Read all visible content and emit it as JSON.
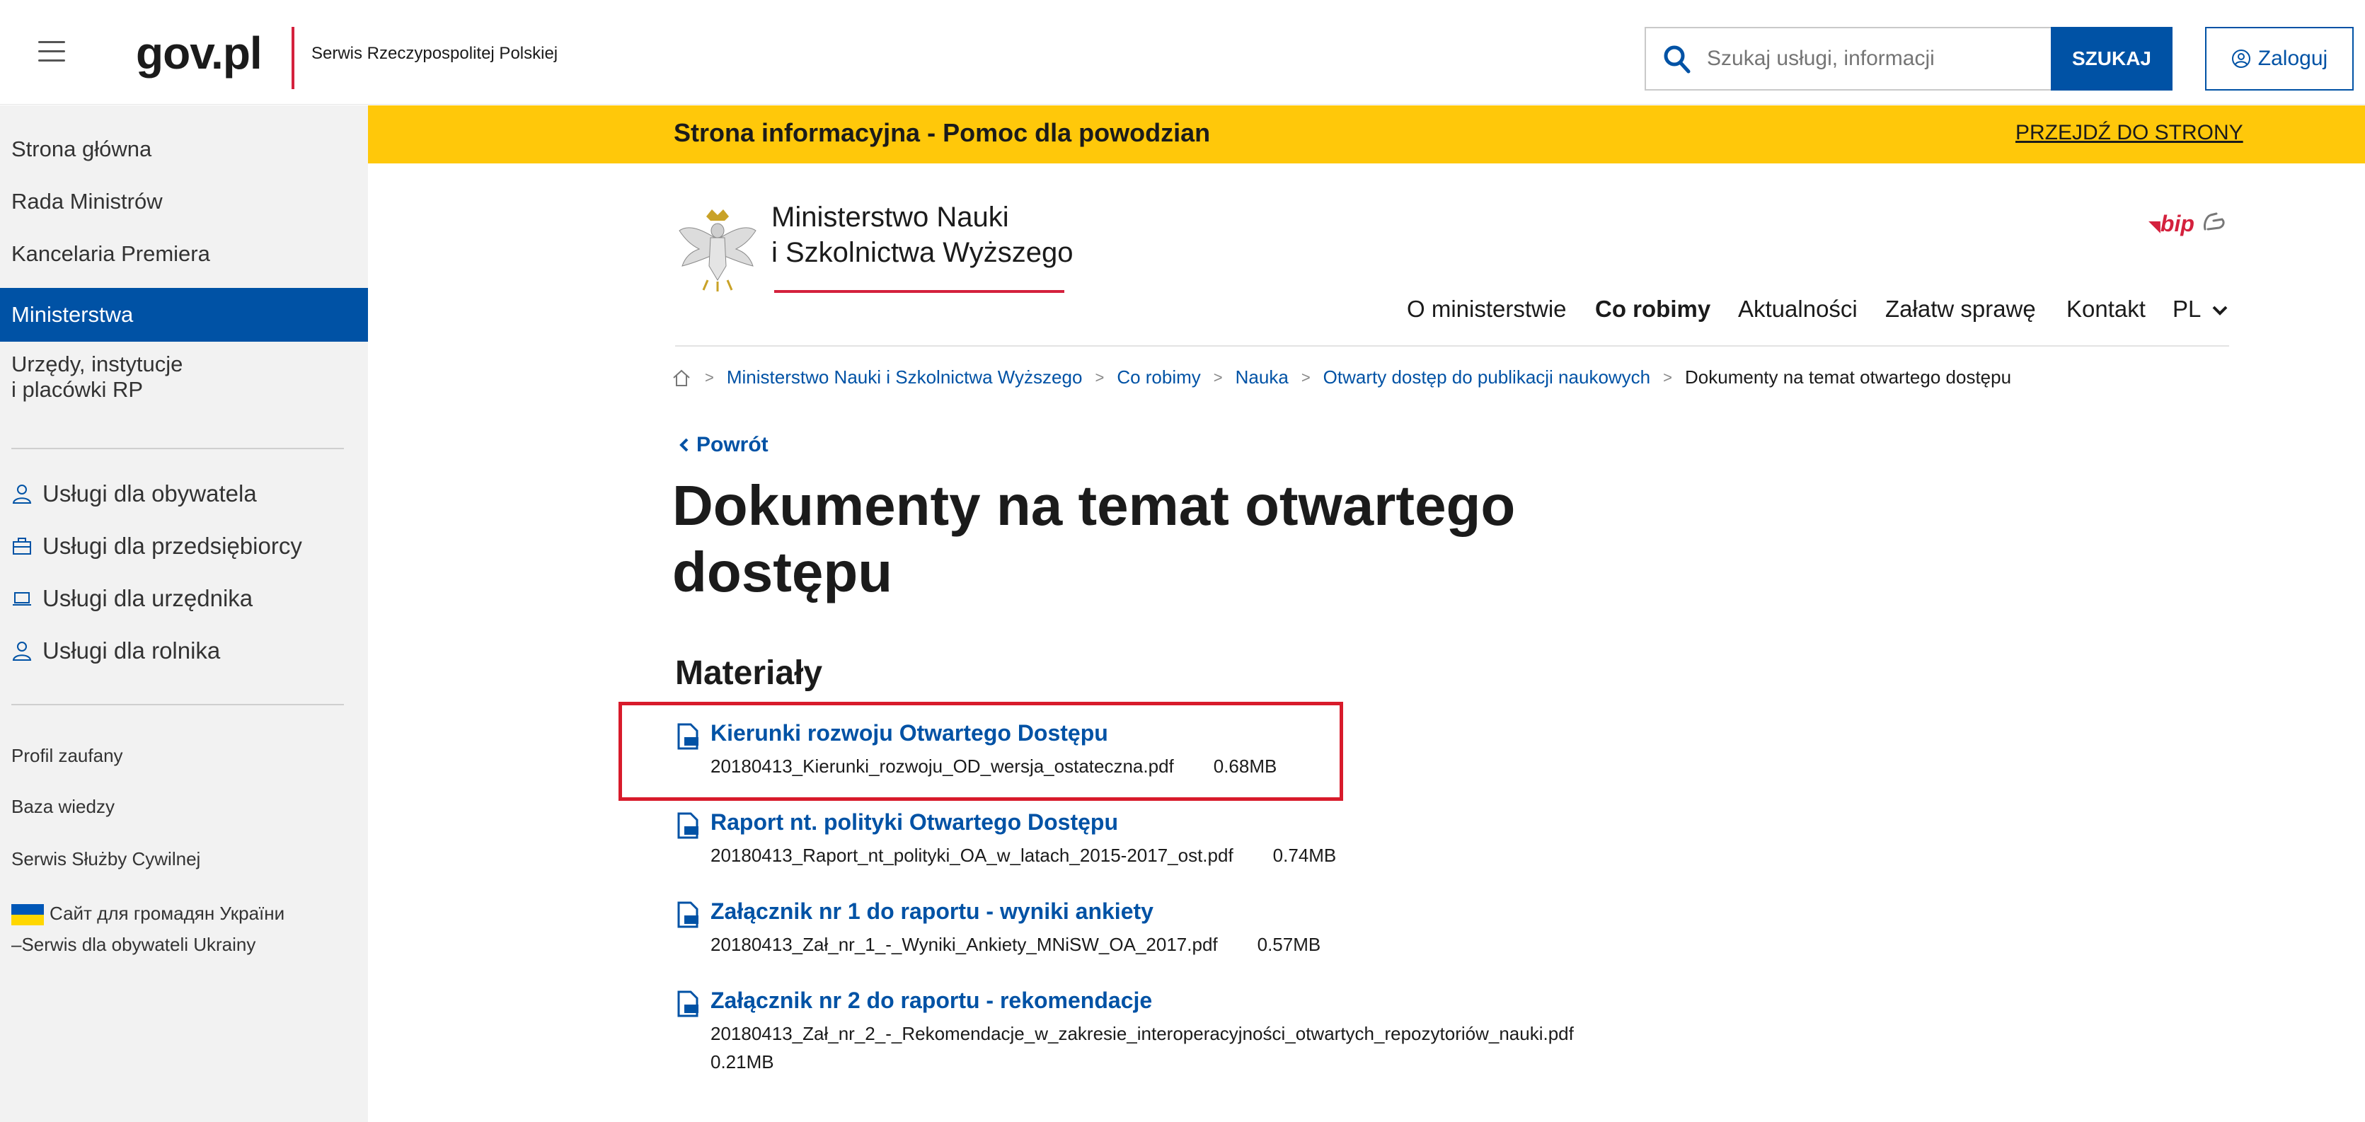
{
  "header": {
    "logo": "gov.pl",
    "serwis": "Serwis Rzeczypospolitej Polskiej",
    "search_placeholder": "Szukaj usługi, informacji",
    "search_button": "SZUKAJ",
    "login": "Zaloguj"
  },
  "banner": {
    "title": "Strona informacyjna - Pomoc dla powodzian",
    "link": "PRZEJDŹ DO STRONY",
    "color": "#ffc80a"
  },
  "sidebar": {
    "main": [
      "Strona główna",
      "Rada Ministrów",
      "Kancelaria Premiera",
      "Ministerstwa",
      "Urzędy, instytucje",
      "i placówki RP"
    ],
    "active": "Ministerstwa",
    "services": [
      {
        "label": "Usługi dla obywatela",
        "icon": "person-icon"
      },
      {
        "label": "Usługi dla przedsiębiorcy",
        "icon": "briefcase-icon"
      },
      {
        "label": "Usługi dla urzędnika",
        "icon": "laptop-icon"
      },
      {
        "label": "Usługi dla rolnika",
        "icon": "person-icon"
      }
    ],
    "small": [
      "Profil zaufany",
      "Baza wiedzy",
      "Serwis Służby Cywilnej"
    ],
    "ukraine_line1": "Сайт для громадян України",
    "ukraine_line2": "–Serwis dla obywateli Ukrainy"
  },
  "ministry": {
    "name_line1": "Ministerstwo Nauki",
    "name_line2": "i Szkolnictwa Wyższego",
    "bip": "bip"
  },
  "nav": [
    "O ministerstwie",
    "Co robimy",
    "Aktualności",
    "Załatw sprawę",
    "Kontakt",
    "PL"
  ],
  "breadcrumb": [
    "Ministerstwo Nauki i Szkolnictwa Wyższego",
    "Co robimy",
    "Nauka",
    "Otwarty dostęp do publikacji naukowych",
    "Dokumenty na temat otwartego dostępu"
  ],
  "back": "Powrót",
  "title_line1": "Dokumenty na temat otwartego",
  "title_line2": "dostępu",
  "section": "Materiały",
  "files": [
    {
      "title": "Kierunki rozwoju Otwartego Dostępu",
      "file": "20180413_Kierunki_rozwoju_OD_wersja_ostateczna.pdf",
      "size": "0.68MB"
    },
    {
      "title": "Raport nt. polityki Otwartego Dostępu",
      "file": "20180413_Raport_nt_polityki_OA_w_latach_2015-2017_ost.pdf",
      "size": "0.74MB"
    },
    {
      "title": "Załącznik nr 1 do raportu - wyniki ankiety",
      "file": "20180413_Zał_nr_1_-_Wyniki_Ankiety_MNiSW_OA_2017.pdf",
      "size": "0.57MB"
    },
    {
      "title": "Załącznik nr 2 do raportu - rekomendacje",
      "file": "20180413_Zał_nr_2_-_Rekomendacje_w_zakresie_interoperacyjności_otwartych_repozytoriów_nauki.pdf",
      "size": "0.21MB"
    }
  ],
  "colors": {
    "accent": "#0052a5",
    "brand_red": "#d4213d",
    "highlight": "#d81b2b"
  }
}
